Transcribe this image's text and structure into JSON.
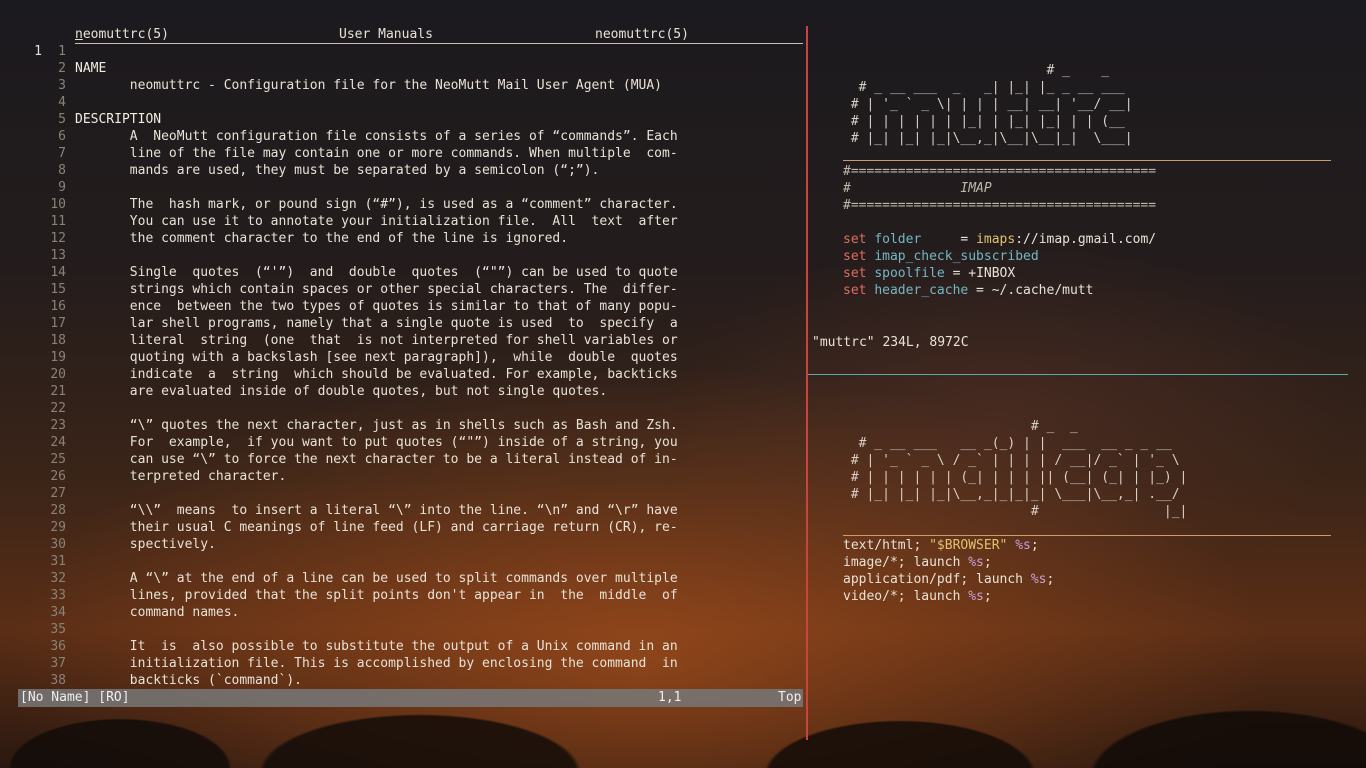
{
  "left_pane": {
    "header": {
      "left": "neomuttrc(5)",
      "center": "User Manuals",
      "right": "neomuttrc(5)"
    },
    "current_line_number": "1",
    "lines": [
      {
        "n": "1",
        "t": ""
      },
      {
        "n": "2",
        "t": "NAME"
      },
      {
        "n": "3",
        "t": "       neomuttrc - Configuration file for the NeoMutt Mail User Agent (MUA)"
      },
      {
        "n": "4",
        "t": ""
      },
      {
        "n": "5",
        "t": "DESCRIPTION"
      },
      {
        "n": "6",
        "t": "       A  NeoMutt configuration file consists of a series of “commands”. Each"
      },
      {
        "n": "7",
        "t": "       line of the file may contain one or more commands. When multiple  com-"
      },
      {
        "n": "8",
        "t": "       mands are used, they must be separated by a semicolon (“;”)."
      },
      {
        "n": "9",
        "t": ""
      },
      {
        "n": "10",
        "t": "       The  hash mark, or pound sign (“#”), is used as a “comment” character."
      },
      {
        "n": "11",
        "t": "       You can use it to annotate your initialization file.  All  text  after"
      },
      {
        "n": "12",
        "t": "       the comment character to the end of the line is ignored."
      },
      {
        "n": "13",
        "t": ""
      },
      {
        "n": "14",
        "t": "       Single  quotes  (“'”)  and  double  quotes  (“\"”) can be used to quote"
      },
      {
        "n": "15",
        "t": "       strings which contain spaces or other special characters. The  differ-"
      },
      {
        "n": "16",
        "t": "       ence  between the two types of quotes is similar to that of many popu-"
      },
      {
        "n": "17",
        "t": "       lar shell programs, namely that a single quote is used  to  specify  a"
      },
      {
        "n": "18",
        "t": "       literal  string  (one  that  is not interpreted for shell variables or"
      },
      {
        "n": "19",
        "t": "       quoting with a backslash [see next paragraph]),  while  double  quotes"
      },
      {
        "n": "20",
        "t": "       indicate  a  string  which should be evaluated. For example, backticks"
      },
      {
        "n": "21",
        "t": "       are evaluated inside of double quotes, but not single quotes."
      },
      {
        "n": "22",
        "t": ""
      },
      {
        "n": "23",
        "t": "       “\\” quotes the next character, just as in shells such as Bash and Zsh."
      },
      {
        "n": "24",
        "t": "       For  example,  if you want to put quotes (“\"”) inside of a string, you"
      },
      {
        "n": "25",
        "t": "       can use “\\” to force the next character to be a literal instead of in-"
      },
      {
        "n": "26",
        "t": "       terpreted character."
      },
      {
        "n": "27",
        "t": ""
      },
      {
        "n": "28",
        "t": "       “\\\\”  means  to insert a literal “\\” into the line. “\\n” and “\\r” have"
      },
      {
        "n": "29",
        "t": "       their usual C meanings of line feed (LF) and carriage return (CR), re-"
      },
      {
        "n": "30",
        "t": "       spectively."
      },
      {
        "n": "31",
        "t": ""
      },
      {
        "n": "32",
        "t": "       A “\\” at the end of a line can be used to split commands over multiple"
      },
      {
        "n": "33",
        "t": "       lines, provided that the split points don't appear in  the  middle  of"
      },
      {
        "n": "34",
        "t": "       command names."
      },
      {
        "n": "35",
        "t": ""
      },
      {
        "n": "36",
        "t": "       It  is  also possible to substitute the output of a Unix command in an"
      },
      {
        "n": "37",
        "t": "       initialization file. This is accomplished by enclosing the command  in"
      },
      {
        "n": "38",
        "t": "       backticks (`command`)."
      }
    ],
    "status": {
      "name": "[No Name] [RO]",
      "position": "1,1",
      "scroll": "Top"
    }
  },
  "right_top": {
    "banner": [
      "                          # _    _",
      "  # _ __ ___  _   _| |_| |_ _ __ ___",
      " # | '_ ` _ \\| | | | __| __| '__/ __|",
      " # | | | | | | |_| | |_| |_| | | (__",
      " # |_| |_| |_|\\__,_|\\__|\\__|_|  \\___|"
    ],
    "section_rule": "#=======================================",
    "section_title": "#              IMAP",
    "settings": [
      {
        "kw": "set",
        "var": "folder",
        "pad": "    ",
        "eq": " = ",
        "val_hl": "imaps",
        "val_rest": "://imap.gmail.com/"
      },
      {
        "kw": "set",
        "var": "imap_check_subscribed",
        "pad": "",
        "eq": "",
        "val_hl": "",
        "val_rest": ""
      },
      {
        "kw": "set",
        "var": "spoolfile",
        "pad": "",
        "eq": " = ",
        "val_hl": "",
        "val_rest": "+INBOX"
      },
      {
        "kw": "set",
        "var": "header_cache",
        "pad": "",
        "eq": " = ",
        "val_hl": "",
        "val_rest": "~/.cache/mutt"
      }
    ],
    "file_message": "\"muttrc\" 234L, 8972C"
  },
  "right_bottom": {
    "banner": [
      "                        # _  _",
      "  # _ __ ___   __ _(_) | |  ___  __ _ _ __",
      " # | '_ ` _ \\ / _` | | | | / __|/ _` | '_ \\",
      " # | | | | | | (_| | | | || (__| (_| | |_) |",
      " # |_| |_| |_|\\__,_|_|_|_| \\___|\\__,_| .__/",
      "                        #                |_|"
    ],
    "entries": [
      {
        "pre": "text/html; ",
        "str": "\"$BROWSER\"",
        "pct": " %s",
        "end": ";"
      },
      {
        "pre": "image/*; launch",
        "str": "",
        "pct": " %s",
        "end": ";"
      },
      {
        "pre": "application/pdf; launch",
        "str": "",
        "pct": " %s",
        "end": ";"
      },
      {
        "pre": "video/*; launch",
        "str": "",
        "pct": " %s",
        "end": ";"
      }
    ]
  },
  "colors": {
    "split": "#c7443f",
    "keyword": "#e06c5f",
    "variable": "#73b7c4",
    "string": "#e1c26e",
    "format": "#c8a0d6",
    "rule_orange": "#cc9b6e",
    "rule_teal": "#5aa8a8"
  }
}
